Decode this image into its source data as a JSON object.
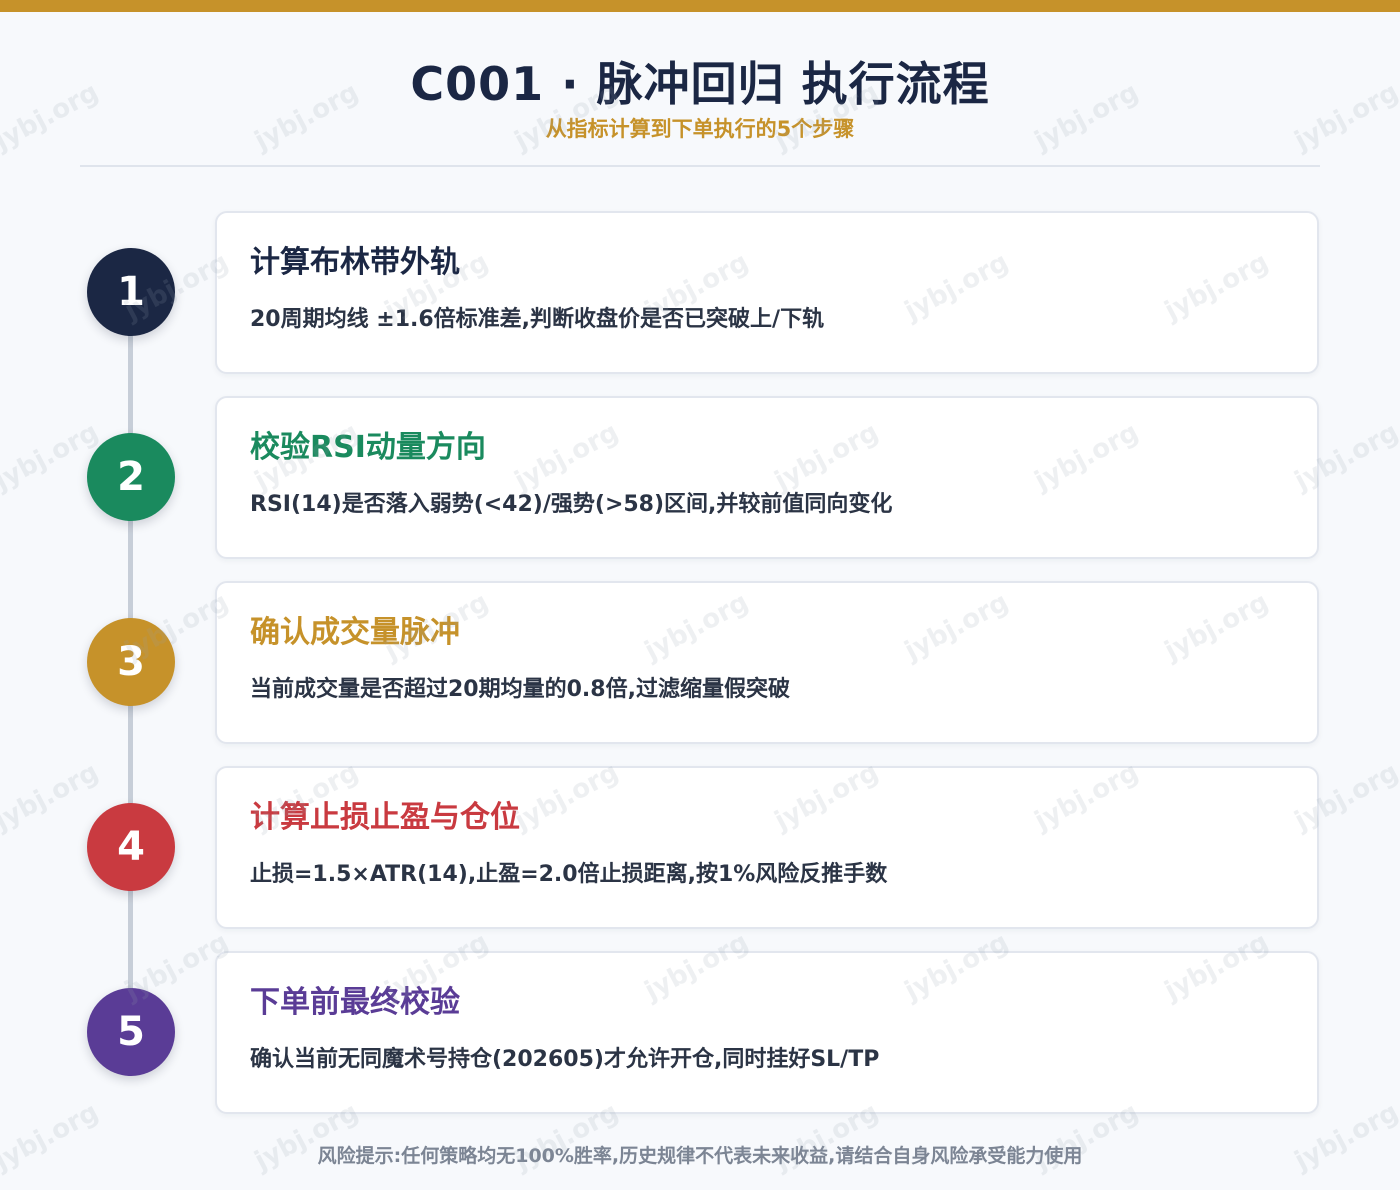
{
  "header": {
    "title": "C001 · 脉冲回归 执行流程",
    "subtitle": "从指标计算到下单执行的5个步骤"
  },
  "steps": [
    {
      "number": "1",
      "title": "计算布林带外轨",
      "description": "20周期均线 ±1.6倍标准差,判断收盘价是否已突破上/下轨",
      "color": "#1b2744"
    },
    {
      "number": "2",
      "title": "校验RSI动量方向",
      "description": "RSI(14)是否落入弱势(<42)/强势(>58)区间,并较前值同向变化",
      "color": "#1a8a5e"
    },
    {
      "number": "3",
      "title": "确认成交量脉冲",
      "description": "当前成交量是否超过20期均量的0.8倍,过滤缩量假突破",
      "color": "#c6922a"
    },
    {
      "number": "4",
      "title": "计算止损止盈与仓位",
      "description": "止损=1.5×ATR(14),止盈=2.0倍止损距离,按1%风险反推手数",
      "color": "#c93a40"
    },
    {
      "number": "5",
      "title": "下单前最终校验",
      "description": "确认当前无同魔术号持仓(202605)才允许开仓,同时挂好SL/TP",
      "color": "#5a3c96"
    }
  ],
  "footer": {
    "disclaimer": "风险提示:任何策略均无100%胜率,历史规律不代表未来收益,请结合自身风险承受能力使用"
  },
  "watermark": {
    "text": "jybj.org"
  },
  "colors": {
    "accent": "#c6922a",
    "navy": "#1b2744",
    "background": "#f7f9fc"
  }
}
